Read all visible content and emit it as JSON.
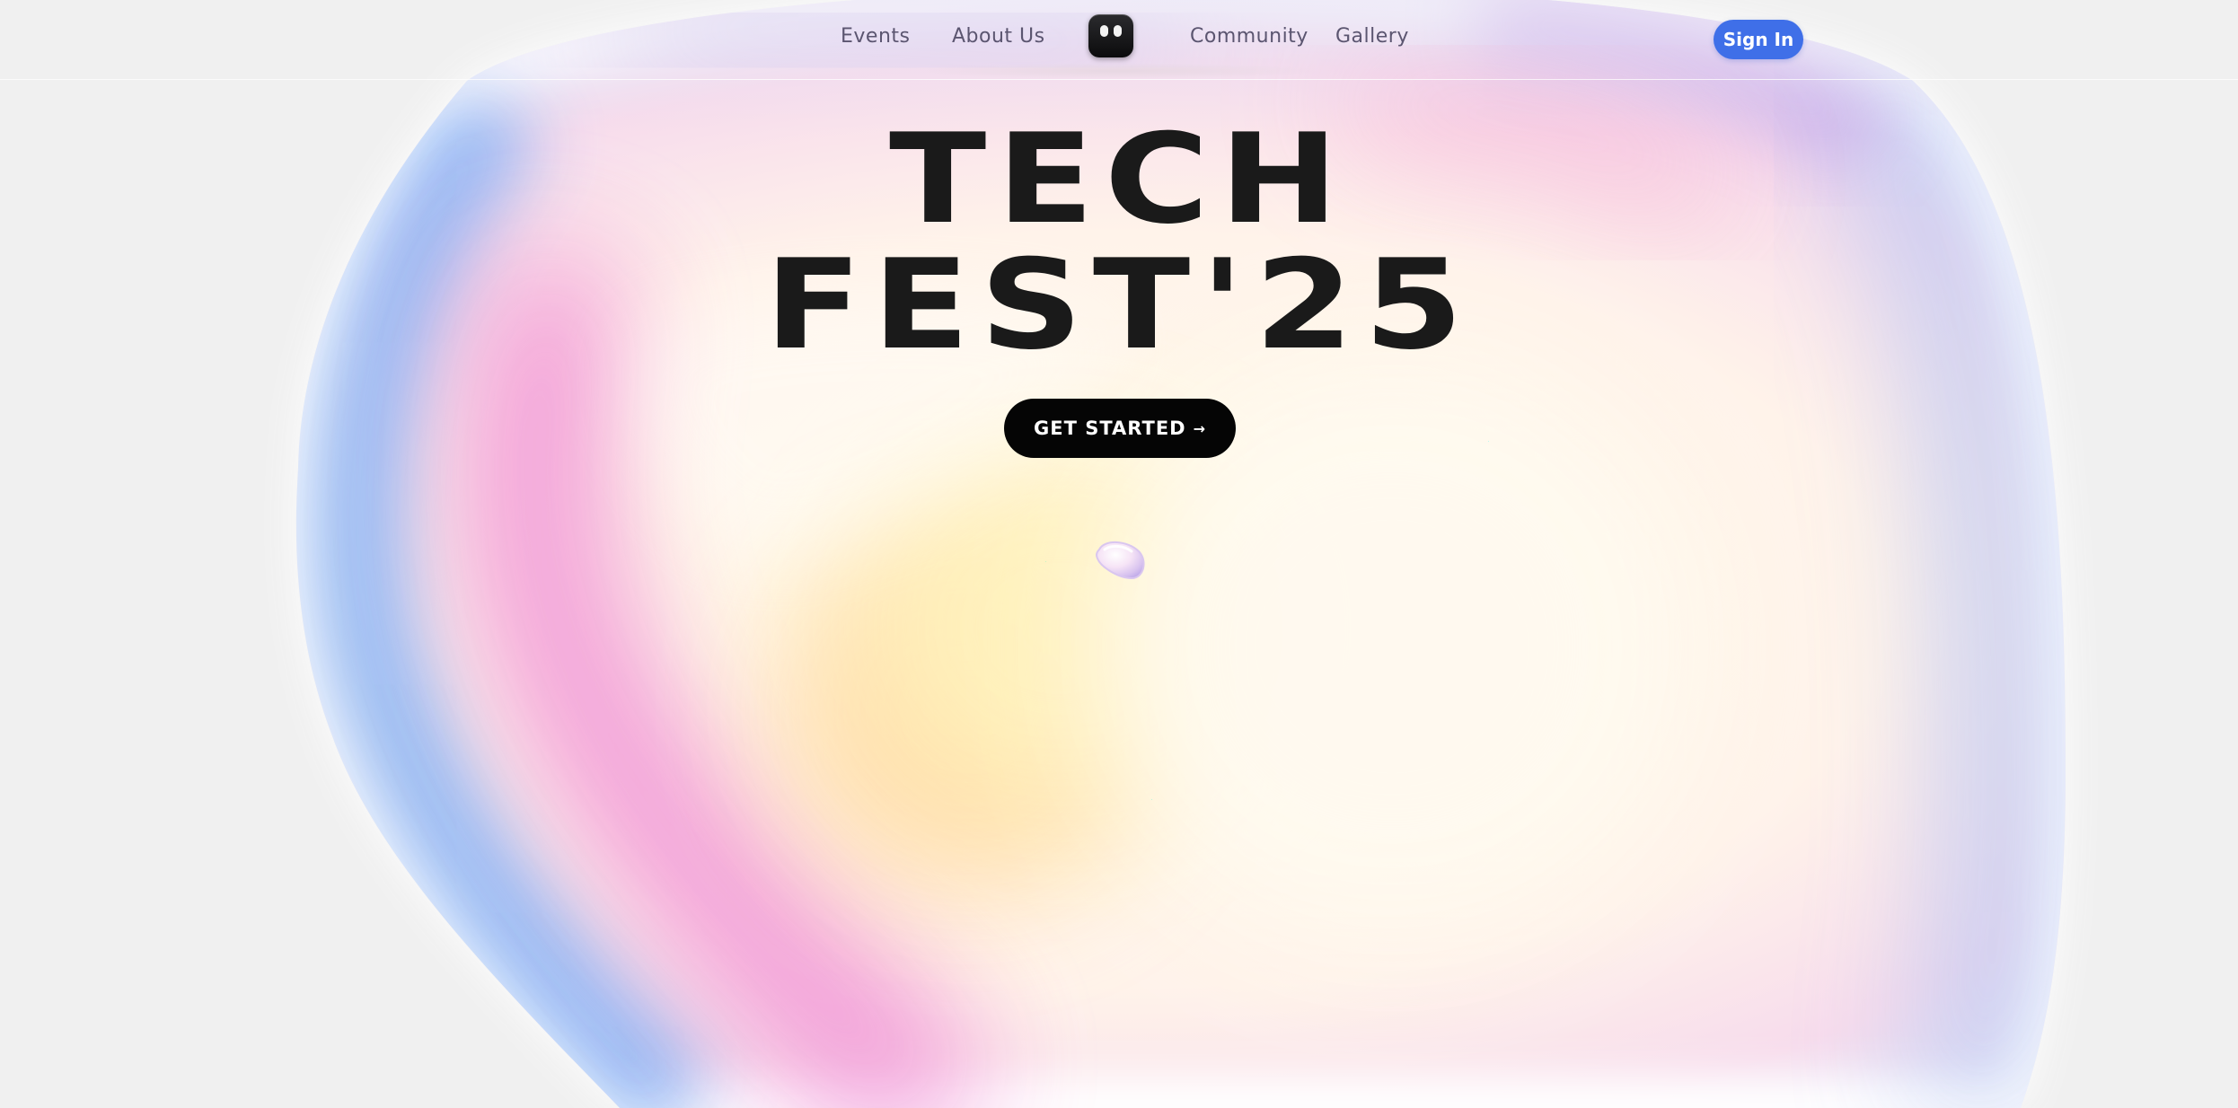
{
  "nav": {
    "links": [
      "Events",
      "About Us",
      "Community",
      "Gallery"
    ],
    "signin_label": "Sign In"
  },
  "hero": {
    "line1": "TECH",
    "line2": "FEST'25",
    "cta_label": "GET STARTED",
    "cta_arrow": "→"
  },
  "colors": {
    "accent": "#3f6fe8",
    "cta": "#050505",
    "text": "#1a1a1a",
    "nav_text": "#5b5570"
  },
  "icons": {
    "logo": "robot-face-icon",
    "arrow": "arrow-right-icon",
    "decor": "glass-pebble-icon"
  }
}
